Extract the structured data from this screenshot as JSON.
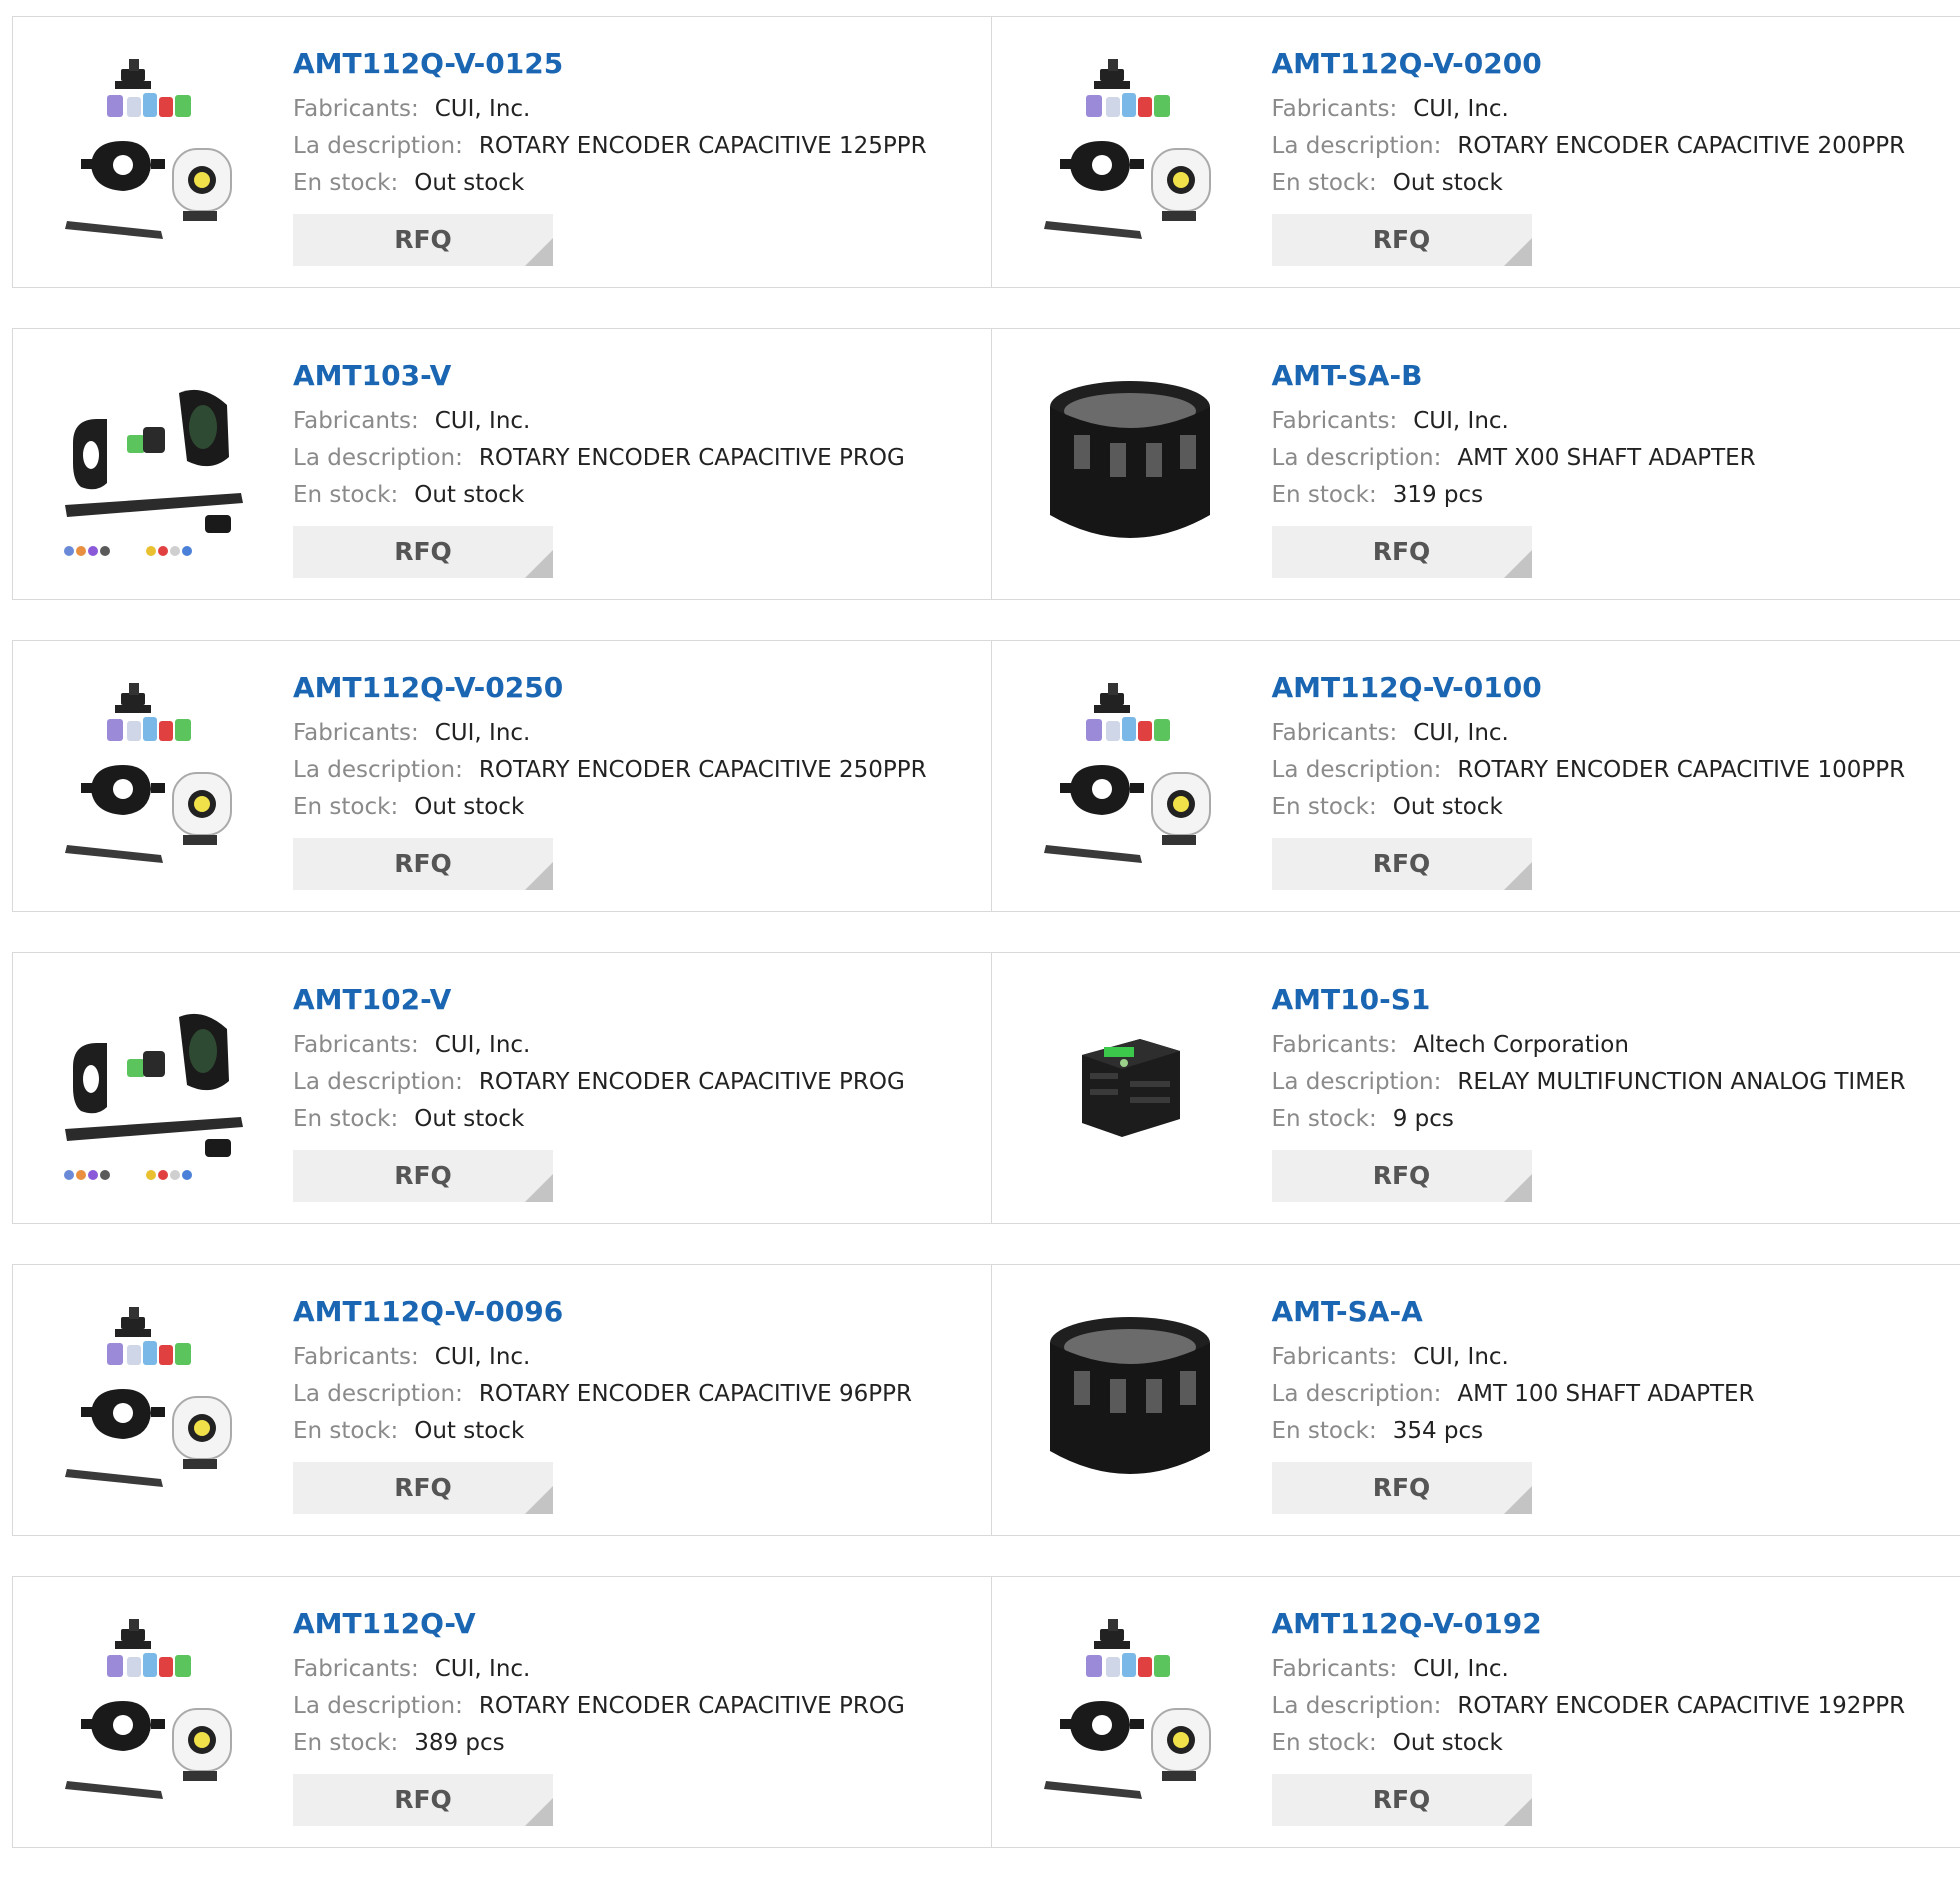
{
  "labels": {
    "manufacturer": "Fabricants:",
    "description": "La description:",
    "stock": "En stock:",
    "rfq": "RFQ"
  },
  "products": [
    {
      "part": "AMT112Q-V-0125",
      "manufacturer": "CUI, Inc.",
      "description": "ROTARY ENCODER CAPACITIVE 125PPR",
      "stock": "Out stock",
      "image": "encoder-kit-icon"
    },
    {
      "part": "AMT112Q-V-0200",
      "manufacturer": "CUI, Inc.",
      "description": "ROTARY ENCODER CAPACITIVE 200PPR",
      "stock": "Out stock",
      "image": "encoder-kit-icon"
    },
    {
      "part": "AMT103-V",
      "manufacturer": "CUI, Inc.",
      "description": "ROTARY ENCODER CAPACITIVE PROG",
      "stock": "Out stock",
      "image": "encoder-exploded-icon"
    },
    {
      "part": "AMT-SA-B",
      "manufacturer": "CUI, Inc.",
      "description": "AMT X00 SHAFT ADAPTER",
      "stock": "319 pcs",
      "image": "shaft-adapter-icon"
    },
    {
      "part": "AMT112Q-V-0250",
      "manufacturer": "CUI, Inc.",
      "description": "ROTARY ENCODER CAPACITIVE 250PPR",
      "stock": "Out stock",
      "image": "encoder-kit-icon"
    },
    {
      "part": "AMT112Q-V-0100",
      "manufacturer": "CUI, Inc.",
      "description": "ROTARY ENCODER CAPACITIVE 100PPR",
      "stock": "Out stock",
      "image": "encoder-kit-icon"
    },
    {
      "part": "AMT102-V",
      "manufacturer": "CUI, Inc.",
      "description": "ROTARY ENCODER CAPACITIVE PROG",
      "stock": "Out stock",
      "image": "encoder-exploded-icon"
    },
    {
      "part": "AMT10-S1",
      "manufacturer": "Altech Corporation",
      "description": "RELAY MULTIFUNCTION ANALOG TIMER",
      "stock": "9 pcs",
      "image": "din-relay-icon"
    },
    {
      "part": "AMT112Q-V-0096",
      "manufacturer": "CUI, Inc.",
      "description": "ROTARY ENCODER CAPACITIVE 96PPR",
      "stock": "Out stock",
      "image": "encoder-kit-icon"
    },
    {
      "part": "AMT-SA-A",
      "manufacturer": "CUI, Inc.",
      "description": "AMT 100 SHAFT ADAPTER",
      "stock": "354 pcs",
      "image": "shaft-adapter-icon"
    },
    {
      "part": "AMT112Q-V",
      "manufacturer": "CUI, Inc.",
      "description": "ROTARY ENCODER CAPACITIVE PROG",
      "stock": "389 pcs",
      "image": "encoder-kit-icon"
    },
    {
      "part": "AMT112Q-V-0192",
      "manufacturer": "CUI, Inc.",
      "description": "ROTARY ENCODER CAPACITIVE 192PPR",
      "stock": "Out stock",
      "image": "encoder-kit-icon"
    }
  ],
  "colors": {
    "link": "#1a66b2",
    "label": "#8a8a8a",
    "value": "#222222",
    "button_bg": "#efefef",
    "border": "#d9d9d9"
  }
}
